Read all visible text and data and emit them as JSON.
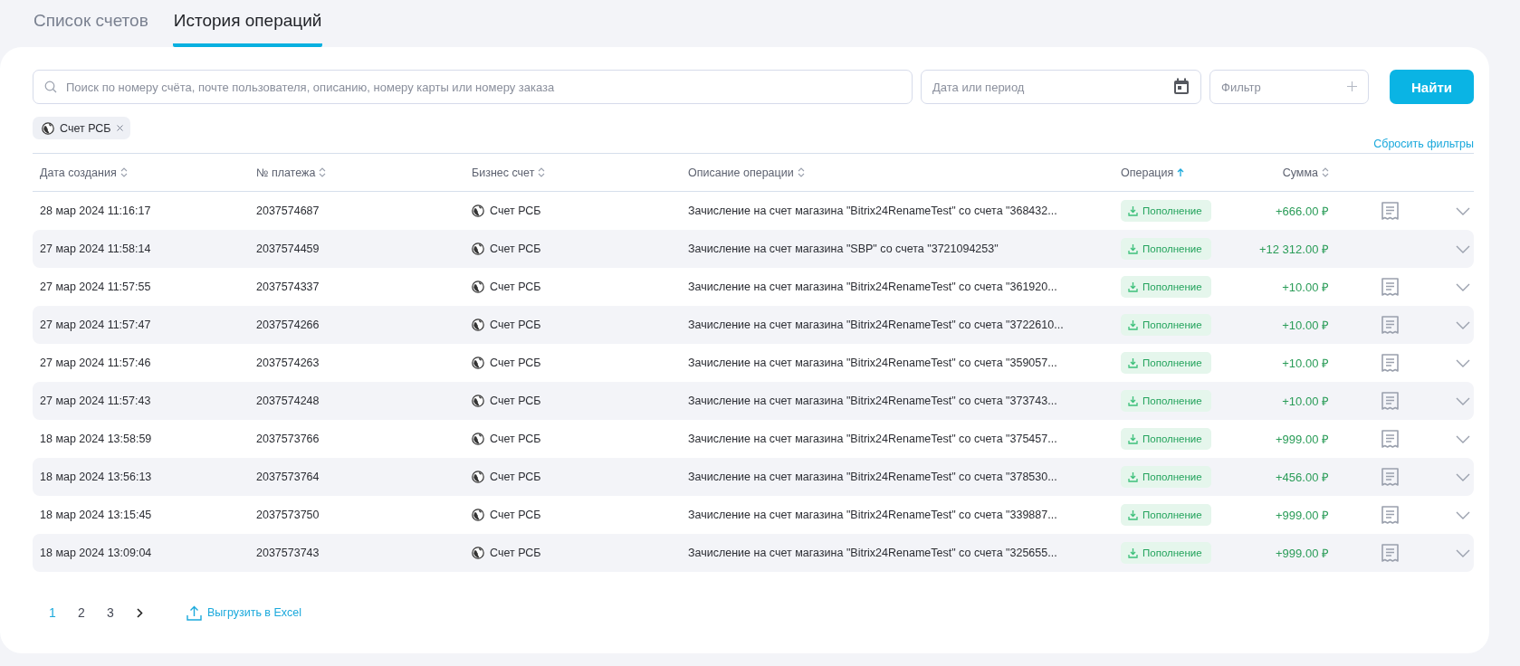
{
  "tabs": [
    {
      "label": "Список счетов",
      "selected": false
    },
    {
      "label": "История операций",
      "selected": true
    }
  ],
  "search": {
    "placeholder": "Поиск по номеру счёта, почте пользователя, описанию, номеру карты или номеру заказа"
  },
  "date_field": {
    "placeholder": "Дата или период"
  },
  "filter_field": {
    "placeholder": "Фильтр"
  },
  "find_button": "Найти",
  "chips": [
    {
      "label": "Счет РСБ"
    }
  ],
  "reset_link": "Сбросить фильтры",
  "table": {
    "columns": [
      {
        "label": "Дата создания",
        "sorted": false
      },
      {
        "label": "№ платежа",
        "sorted": false
      },
      {
        "label": "Бизнес счет",
        "sorted": false
      },
      {
        "label": "Описание операции",
        "sorted": false
      },
      {
        "label": "Операция",
        "sorted": true
      },
      {
        "label": "Сумма",
        "sorted": false
      }
    ],
    "rows": [
      {
        "date": "28 мар 2024 11:16:17",
        "number": "2037574687",
        "account": "Счет РСБ",
        "description": "Зачисление на счет магазина \"Bitrix24RenameTest\" со счета \"368432...",
        "operation": "Пополнение",
        "amount": "+666.00 ₽",
        "receipt": true
      },
      {
        "date": "27 мар 2024 11:58:14",
        "number": "2037574459",
        "account": "Счет РСБ",
        "description": "Зачисление на счет магазина \"SBP\" со счета \"3721094253\"",
        "operation": "Пополнение",
        "amount": "+12 312.00 ₽",
        "receipt": false
      },
      {
        "date": "27 мар 2024 11:57:55",
        "number": "2037574337",
        "account": "Счет РСБ",
        "description": "Зачисление на счет магазина \"Bitrix24RenameTest\" со счета \"361920...",
        "operation": "Пополнение",
        "amount": "+10.00 ₽",
        "receipt": true
      },
      {
        "date": "27 мар 2024 11:57:47",
        "number": "2037574266",
        "account": "Счет РСБ",
        "description": "Зачисление на счет магазина \"Bitrix24RenameTest\" со счета \"3722610...",
        "operation": "Пополнение",
        "amount": "+10.00 ₽",
        "receipt": true
      },
      {
        "date": "27 мар 2024 11:57:46",
        "number": "2037574263",
        "account": "Счет РСБ",
        "description": "Зачисление на счет магазина \"Bitrix24RenameTest\" со счета \"359057...",
        "operation": "Пополнение",
        "amount": "+10.00 ₽",
        "receipt": true
      },
      {
        "date": "27 мар 2024 11:57:43",
        "number": "2037574248",
        "account": "Счет РСБ",
        "description": "Зачисление на счет магазина \"Bitrix24RenameTest\" со счета \"373743...",
        "operation": "Пополнение",
        "amount": "+10.00 ₽",
        "receipt": true
      },
      {
        "date": "18 мар 2024 13:58:59",
        "number": "2037573766",
        "account": "Счет РСБ",
        "description": "Зачисление на счет магазина \"Bitrix24RenameTest\" со счета \"375457...",
        "operation": "Пополнение",
        "amount": "+999.00 ₽",
        "receipt": true
      },
      {
        "date": "18 мар 2024 13:56:13",
        "number": "2037573764",
        "account": "Счет РСБ",
        "description": "Зачисление на счет магазина \"Bitrix24RenameTest\" со счета \"378530...",
        "operation": "Пополнение",
        "amount": "+456.00 ₽",
        "receipt": true
      },
      {
        "date": "18 мар 2024 13:15:45",
        "number": "2037573750",
        "account": "Счет РСБ",
        "description": "Зачисление на счет магазина \"Bitrix24RenameTest\" со счета \"339887...",
        "operation": "Пополнение",
        "amount": "+999.00 ₽",
        "receipt": true
      },
      {
        "date": "18 мар 2024 13:09:04",
        "number": "2037573743",
        "account": "Счет РСБ",
        "description": "Зачисление на счет магазина \"Bitrix24RenameTest\" со счета \"325655...",
        "operation": "Пополнение",
        "amount": "+999.00 ₽",
        "receipt": true
      }
    ]
  },
  "pagination": {
    "pages": [
      {
        "label": "1",
        "selected": true
      },
      {
        "label": "2",
        "selected": false
      },
      {
        "label": "3",
        "selected": false
      }
    ]
  },
  "export_link": "Выгрузить в Excel"
}
